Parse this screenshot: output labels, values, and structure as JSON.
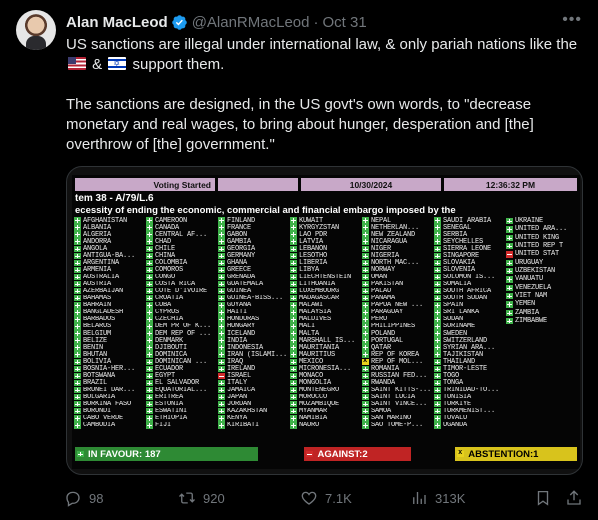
{
  "author": {
    "name": "Alan MacLeod",
    "handle": "@AlanRMacLeod",
    "separator": "·",
    "date": "Oct 31"
  },
  "icons": {
    "verified": "verified-badge-icon",
    "more": "more-options-icon",
    "flag1": "us-flag-icon",
    "flag2": "israel-flag-icon"
  },
  "tweet": {
    "line1_a": "US sanctions are illegal under international law, & only pariah nations like the",
    "line1_amp": "&",
    "line1_b": "support them.",
    "paragraph2": "The sanctions are designed, in the US govt's own words, to  \"decrease monetary and real wages, to bring about hunger, desperation and [the] overthrow of [the] government.\""
  },
  "board": {
    "voting_label": "Voting Started",
    "date": "10/30/2024",
    "time": "12:36:32 PM",
    "item": "tem 38 - A/79/L.6",
    "title": "ecessity of ending the economic, commercial and financial embargo imposed by the",
    "columns": [
      [
        "AFGHANISTAN",
        "ALBANIA",
        "ALGERIA",
        "ANDORRA",
        "ANGOLA",
        "ANTIGUA-BA...",
        "ARGENTINA",
        "ARMENIA",
        "AUSTRALIA",
        "AUSTRIA",
        "AZERBAIJAN",
        "BAHAMAS",
        "BAHRAIN",
        "BANGLADESH",
        "BARBADOS",
        "BELARUS",
        "BELGIUM",
        "BELIZE",
        "BENIN",
        "BHUTAN",
        "BOLIVIA",
        "BOSNIA-HER...",
        "BOTSWANA",
        "BRAZIL",
        "BRUNEI DAR...",
        "BULGARIA",
        "BURKINA FASO",
        "BURUNDI",
        "CABO VERDE",
        "CAMBODIA"
      ],
      [
        "CAMEROON",
        "CANADA",
        "CENTRAL AF...",
        "CHAD",
        "CHILE",
        "CHINA",
        "COLOMBIA",
        "COMOROS",
        "CONGO",
        "COSTA RICA",
        "COTE D'IVOIRE",
        "CROATIA",
        "CUBA",
        "CYPRUS",
        "CZECHIA",
        "DEM PR OF K...",
        "DEM REP OF ...",
        "DENMARK",
        "DJIBOUTI",
        "DOMINICA",
        "DOMINICAN ...",
        "ECUADOR",
        "EGYPT",
        "EL SALVADOR",
        "EQUATORIAL...",
        "ERITREA",
        "ESTONIA",
        "ESWATINI",
        "ETHIOPIA",
        "FIJI"
      ],
      [
        "FINLAND",
        "FRANCE",
        "GABON",
        "GAMBIA",
        "GEORGIA",
        "GERMANY",
        "GHANA",
        "GREECE",
        "GRENADA",
        "GUATEMALA",
        "GUINEA",
        "GUINEA-BISS...",
        "GUYANA",
        "HAITI",
        "HONDURAS",
        "HUNGARY",
        "ICELAND",
        "INDIA",
        "INDONESIA",
        "IRAN (ISLAMI...",
        "IRAQ",
        "IRELAND",
        "ISRAEL",
        "ITALY",
        "JAMAICA",
        "JAPAN",
        "JORDAN",
        "KAZAKHSTAN",
        "KENYA",
        "KIRIBATI"
      ],
      [
        "KUWAIT",
        "KYRGYZSTAN",
        "LAO PDR",
        "LATVIA",
        "LEBANON",
        "LESOTHO",
        "LIBERIA",
        "LIBYA",
        "LIECHTENSTEIN",
        "LITHUANIA",
        "LUXEMBOURG",
        "MADAGASCAR",
        "MALAWI",
        "MALAYSIA",
        "MALDIVES",
        "MALI",
        "MALTA",
        "MARSHALL IS...",
        "MAURITANIA",
        "MAURITIUS",
        "MEXICO",
        "MICRONESIA...",
        "MONACO",
        "MONGOLIA",
        "MONTENEGRO",
        "MOROCCO",
        "MOZAMBIQUE",
        "MYANMAR",
        "NAMIBIA",
        "NAURU"
      ],
      [
        "NEPAL",
        "NETHERLAN...",
        "NEW ZEALAND",
        "NICARAGUA",
        "NIGER",
        "NIGERIA",
        "NORTH MAC...",
        "NORWAY",
        "OMAN",
        "PAKISTAN",
        "PALAU",
        "PANAMA",
        "PAPUA NEW ...",
        "PARAGUAY",
        "PERU",
        "PHILIPPINES",
        "POLAND",
        "PORTUGAL",
        "QATAR",
        "REP OF KOREA",
        "REP OF MOL...",
        "ROMANIA",
        "RUSSIAN FED...",
        "RWANDA",
        "SAINT KITTS-...",
        "SAINT LUCIA",
        "SAINT VINCE...",
        "SAMOA",
        "SAN MARINO",
        "SAO TOME-P..."
      ],
      [
        "SAUDI ARABIA",
        "SENEGAL",
        "SERBIA",
        "SEYCHELLES",
        "SIERRA LEONE",
        "SINGAPORE",
        "SLOVAKIA",
        "SLOVENIA",
        "SOLOMON IS...",
        "SOMALIA",
        "SOUTH AFRICA",
        "SOUTH SUDAN",
        "SPAIN",
        "SRI LANKA",
        "SUDAN",
        "SURINAME",
        "SWEDEN",
        "SWITZERLAND",
        "SYRIAN ARA...",
        "TAJIKISTAN",
        "THAILAND",
        "TIMOR-LESTE",
        "TOGO",
        "TONGA",
        "TRINIDAD-TO...",
        "TUNISIA",
        "TURKIYE",
        "TURKMENIST...",
        "TUVALU",
        "UGANDA"
      ],
      [
        "UKRAINE",
        "UNITED ARA...",
        "UNITED KING",
        "UNITED REP T",
        "UNITED STAT",
        "URUGUAY",
        "UZBEKISTAN",
        "VANUATU",
        "VENEZUELA",
        "VIET NAM",
        "YEMEN",
        "ZAMBIA",
        "ZIMBABWE"
      ]
    ],
    "no_votes": [
      "ISRAEL",
      "UNITED STAT"
    ],
    "abstain_votes": [
      "REP OF MOL..."
    ],
    "favour_label": "IN FAVOUR: 187",
    "against_label": "AGAINST:2",
    "abstention_label": "ABSTENTION:1"
  },
  "actions": {
    "replies": "98",
    "reposts": "920",
    "likes": "7.1K",
    "views": "313K"
  },
  "colors": {
    "background": "#000000",
    "text": "#e7e9ea",
    "muted": "#71767b",
    "verified": "#1d9bf0",
    "vote_yes": "#3fb24a",
    "vote_no": "#d02b2b",
    "vote_abstain": "#e8d21d"
  }
}
